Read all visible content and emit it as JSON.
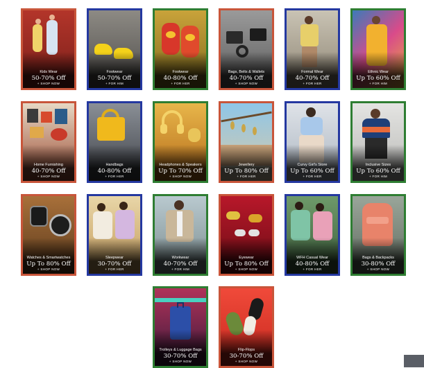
{
  "tiles": [
    {
      "category": "Kids Wear",
      "offer": "50-70% Off",
      "cta": "+ SHOP NOW"
    },
    {
      "category": "Footwear",
      "offer": "50-70% Off",
      "cta": "+ FOR HIM"
    },
    {
      "category": "Footwear",
      "offer": "40-80% Off",
      "cta": "+ FOR HER"
    },
    {
      "category": "Bags, Belts & Wallets",
      "offer": "40-70% Off",
      "cta": "+ SHOP NOW"
    },
    {
      "category": "Formal Wear",
      "offer": "40-70% Off",
      "cta": "+ FOR HER"
    },
    {
      "category": "Ethnic Wear",
      "offer": "Up To 60% Off",
      "cta": "+ FOR HIM"
    },
    {
      "category": "Home Furnishing",
      "offer": "40-70% Off",
      "cta": "+ SHOP NOW"
    },
    {
      "category": "Handbags",
      "offer": "40-80% Off",
      "cta": "+ FOR HER"
    },
    {
      "category": "Headphones & Speakers",
      "offer": "Up To 70% Off",
      "cta": "+ SHOP NOW"
    },
    {
      "category": "Jewellery",
      "offer": "Up To 80% Off",
      "cta": "+ FOR HER"
    },
    {
      "category": "Curvy Girl's Store",
      "offer": "Up To 60% Off",
      "cta": "+ FOR HER"
    },
    {
      "category": "Inclusive Sizes",
      "offer": "Up To 60% Off",
      "cta": "+ FOR HIM"
    },
    {
      "category": "Watches & Smartwatches",
      "offer": "Up To 80% Off",
      "cta": "+ SHOP NOW"
    },
    {
      "category": "Sleepwear",
      "offer": "30-70% Off",
      "cta": "+ FOR HER"
    },
    {
      "category": "Workwear",
      "offer": "40-70% Off",
      "cta": "+ FOR HIM"
    },
    {
      "category": "Eyewear",
      "offer": "Up To 80% Off",
      "cta": "+ SHOP NOW"
    },
    {
      "category": "WFH Casual Wear",
      "offer": "40-80% Off",
      "cta": "+ FOR HER"
    },
    {
      "category": "Bags & Backpacks",
      "offer": "30-80% Off",
      "cta": "+ SHOP NOW"
    },
    {
      "category": "Trolleys & Luggage Bags",
      "offer": "30-70% Off",
      "cta": "+ SHOP NOW"
    },
    {
      "category": "Flip-Flops",
      "offer": "30-70% Off",
      "cta": "+ SHOP NOW"
    }
  ],
  "colors": {
    "border_orange": "#c8553a",
    "border_blue": "#2438a0",
    "border_green": "#2e7d32",
    "background": "#ffffff"
  }
}
